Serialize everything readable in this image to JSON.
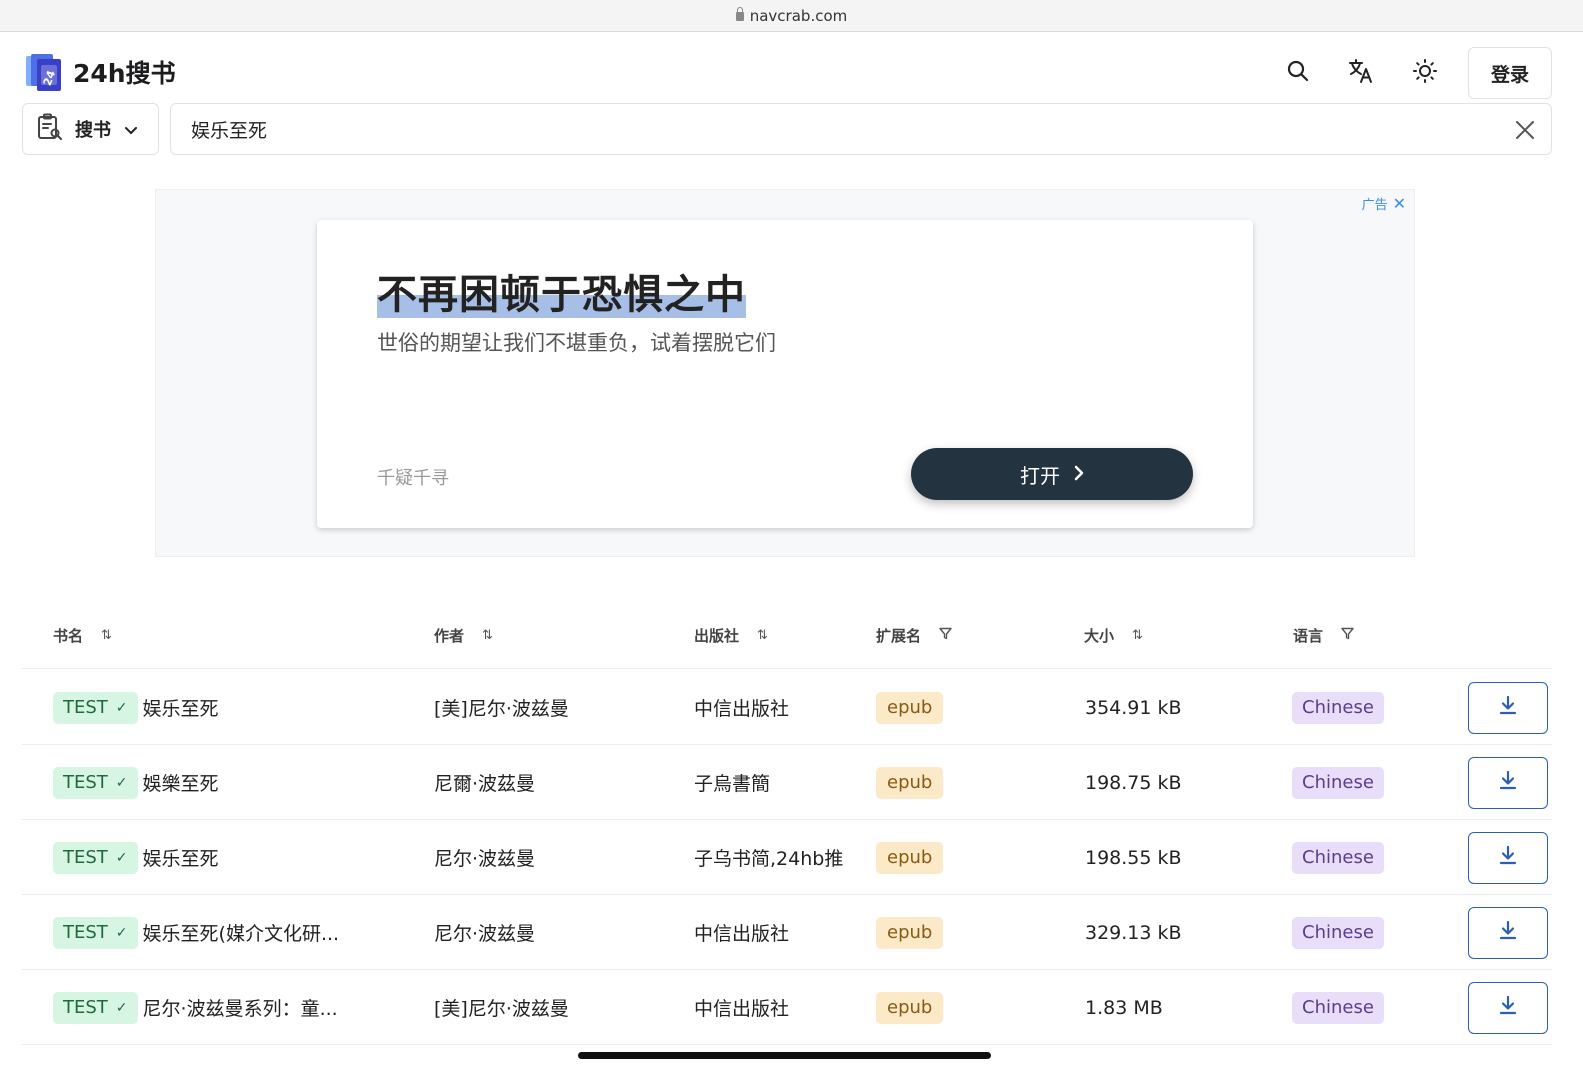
{
  "browser": {
    "url": "navcrab.com"
  },
  "header": {
    "site_name": "24h搜书",
    "login_label": "登录",
    "icons": [
      "search-icon",
      "translate-icon",
      "theme-sun-icon"
    ]
  },
  "search": {
    "scope_label": "搜书",
    "query": "娱乐至死"
  },
  "ad": {
    "label": "广告",
    "title": "不再困顿于恐惧之中",
    "subtitle": "世俗的期望让我们不堪重负，试着摆脱它们",
    "source": "千疑千寻",
    "cta": "打开"
  },
  "table": {
    "columns": [
      "书名",
      "作者",
      "出版社",
      "扩展名",
      "大小",
      "语言"
    ],
    "rows": [
      {
        "tag": "TEST",
        "title": "娱乐至死",
        "author": "[美]尼尔·波兹曼",
        "publisher": "中信出版社",
        "ext": "epub",
        "size": "354.91 kB",
        "language": "Chinese"
      },
      {
        "tag": "TEST",
        "title": "娛樂至死",
        "author": "尼爾·波茲曼",
        "publisher": "子烏書簡",
        "ext": "epub",
        "size": "198.75 kB",
        "language": "Chinese"
      },
      {
        "tag": "TEST",
        "title": "娱乐至死",
        "author": "尼尔·波兹曼",
        "publisher": "子乌书简,24hb推",
        "ext": "epub",
        "size": "198.55 kB",
        "language": "Chinese"
      },
      {
        "tag": "TEST",
        "title": "娱乐至死(媒介文化研...",
        "author": "尼尔·波兹曼",
        "publisher": "中信出版社",
        "ext": "epub",
        "size": "329.13 kB",
        "language": "Chinese"
      },
      {
        "tag": "TEST",
        "title": "尼尔·波兹曼系列：童...",
        "author": "[美]尼尔·波兹曼",
        "publisher": "中信出版社",
        "ext": "epub",
        "size": "1.83 MB",
        "language": "Chinese"
      }
    ]
  }
}
